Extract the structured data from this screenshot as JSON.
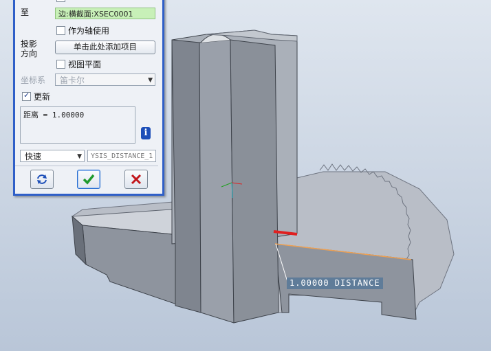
{
  "panel": {
    "top_item_partial": "作为轴使用",
    "to_label": "至",
    "to_value": "边:横截面:XSEC0001",
    "use_as_axis_label": "作为轴使用",
    "projection_label_line1": "投影",
    "projection_label_line2": "方向",
    "add_item_button": "单击此处添加项目",
    "view_plane_label": "视图平面",
    "coord_system_label": "坐标系",
    "coord_system_value": "笛卡尔",
    "update_label": "更新",
    "update_checked": true,
    "result_text": "距离 = 1.00000",
    "mode_value": "快速",
    "analysis_name": "YSIS_DISTANCE_1",
    "info_icon": "info-icon",
    "buttons": {
      "repeat_icon": "cycle-arrows-icon",
      "ok_icon": "checkmark-icon",
      "cancel_icon": "close-x-icon"
    }
  },
  "viewport": {
    "measure_label": "1.00000  DISTANCE"
  },
  "colors": {
    "panel_border": "#2f5fc8",
    "field_highlight": "#c8f0b8",
    "ok_green": "#1e9a2e",
    "cancel_red": "#c2151a",
    "measure_bg": "#5f7c99",
    "measure_line": "#f0a050",
    "edge_marker": "#e02020"
  }
}
